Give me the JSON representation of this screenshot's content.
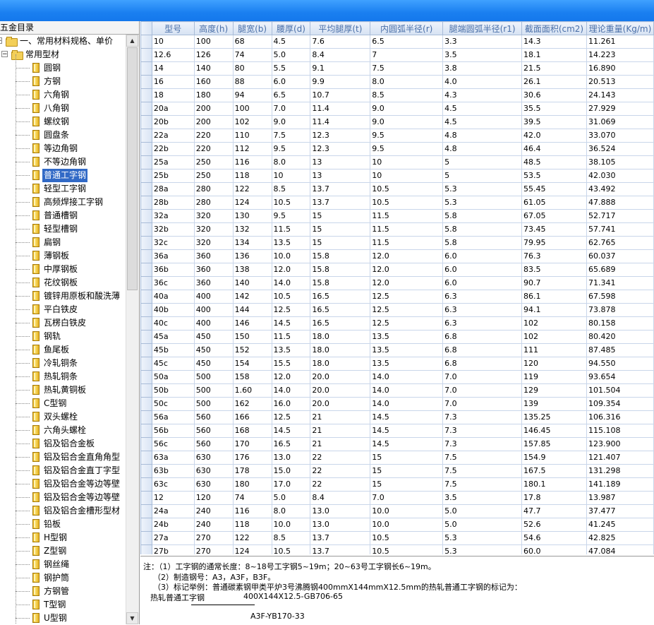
{
  "panel": {
    "title": "五金目录"
  },
  "tree": [
    {
      "label": "一、常用材料规格、单价",
      "level": 0,
      "kind": "folder",
      "expanded": true
    },
    {
      "label": "常用型材",
      "level": 1,
      "kind": "folder",
      "expanded": true
    },
    {
      "label": "圆钢",
      "level": 2,
      "kind": "book"
    },
    {
      "label": "方钢",
      "level": 2,
      "kind": "book"
    },
    {
      "label": "六角钢",
      "level": 2,
      "kind": "book"
    },
    {
      "label": "八角钢",
      "level": 2,
      "kind": "book"
    },
    {
      "label": "螺纹钢",
      "level": 2,
      "kind": "book"
    },
    {
      "label": "圆盘条",
      "level": 2,
      "kind": "book"
    },
    {
      "label": "等边角钢",
      "level": 2,
      "kind": "book"
    },
    {
      "label": "不等边角钢",
      "level": 2,
      "kind": "book"
    },
    {
      "label": "普通工字钢",
      "level": 2,
      "kind": "book",
      "selected": true
    },
    {
      "label": "轻型工字钢",
      "level": 2,
      "kind": "book"
    },
    {
      "label": "高频焊接工字钢",
      "level": 2,
      "kind": "book"
    },
    {
      "label": "普通槽钢",
      "level": 2,
      "kind": "book"
    },
    {
      "label": "轻型槽钢",
      "level": 2,
      "kind": "book"
    },
    {
      "label": "扁钢",
      "level": 2,
      "kind": "book"
    },
    {
      "label": "薄钢板",
      "level": 2,
      "kind": "book"
    },
    {
      "label": "中厚钢板",
      "level": 2,
      "kind": "book"
    },
    {
      "label": "花纹钢板",
      "level": 2,
      "kind": "book"
    },
    {
      "label": "镀锌用原板和酸洗薄",
      "level": 2,
      "kind": "book"
    },
    {
      "label": "平白铁皮",
      "level": 2,
      "kind": "book"
    },
    {
      "label": "瓦楞白铁皮",
      "level": 2,
      "kind": "book"
    },
    {
      "label": "钢轨",
      "level": 2,
      "kind": "book"
    },
    {
      "label": "鱼尾板",
      "level": 2,
      "kind": "book"
    },
    {
      "label": "冷轧铜条",
      "level": 2,
      "kind": "book"
    },
    {
      "label": "热轧铜条",
      "level": 2,
      "kind": "book"
    },
    {
      "label": "热轧黄铜板",
      "level": 2,
      "kind": "book"
    },
    {
      "label": "C型钢",
      "level": 2,
      "kind": "book"
    },
    {
      "label": "双头螺栓",
      "level": 2,
      "kind": "book"
    },
    {
      "label": "六角头螺栓",
      "level": 2,
      "kind": "book"
    },
    {
      "label": "铝及铝合金板",
      "level": 2,
      "kind": "book"
    },
    {
      "label": "铝及铝合金直角角型",
      "level": 2,
      "kind": "book"
    },
    {
      "label": "铝及铝合金直丁字型",
      "level": 2,
      "kind": "book"
    },
    {
      "label": "铝及铝合金等边等壁",
      "level": 2,
      "kind": "book"
    },
    {
      "label": "铝及铝合金等边等壁",
      "level": 2,
      "kind": "book"
    },
    {
      "label": "铝及铝合金槽形型材",
      "level": 2,
      "kind": "book"
    },
    {
      "label": "铅板",
      "level": 2,
      "kind": "book"
    },
    {
      "label": "H型钢",
      "level": 2,
      "kind": "book"
    },
    {
      "label": "Z型钢",
      "level": 2,
      "kind": "book"
    },
    {
      "label": "钢丝绳",
      "level": 2,
      "kind": "book"
    },
    {
      "label": "钢护筒",
      "level": 2,
      "kind": "book"
    },
    {
      "label": "方钢管",
      "level": 2,
      "kind": "book"
    },
    {
      "label": "T型钢",
      "level": 2,
      "kind": "book"
    },
    {
      "label": "U型钢",
      "level": 2,
      "kind": "book"
    }
  ],
  "grid": {
    "columns": [
      "型号",
      "高度(h)",
      "腿宽(b)",
      "腰厚(d)",
      "平均腿厚(t)",
      "内圆弧半径(r)",
      "腿端圆弧半径(r1)",
      "截面面积(cm2)",
      "理论重量(Kg/m)"
    ],
    "rows": [
      [
        "10",
        "100",
        "68",
        "4.5",
        "7.6",
        "6.5",
        "3.3",
        "14.3",
        "11.261"
      ],
      [
        "12.6",
        "126",
        "74",
        "5.0",
        "8.4",
        "7",
        "3.5",
        "18.1",
        "14.223"
      ],
      [
        "14",
        "140",
        "80",
        "5.5",
        "9.1",
        "7.5",
        "3.8",
        "21.5",
        "16.890"
      ],
      [
        "16",
        "160",
        "88",
        "6.0",
        "9.9",
        "8.0",
        "4.0",
        "26.1",
        "20.513"
      ],
      [
        "18",
        "180",
        "94",
        "6.5",
        "10.7",
        "8.5",
        "4.3",
        "30.6",
        "24.143"
      ],
      [
        "20a",
        "200",
        "100",
        "7.0",
        "11.4",
        "9.0",
        "4.5",
        "35.5",
        "27.929"
      ],
      [
        "20b",
        "200",
        "102",
        "9.0",
        "11.4",
        "9.0",
        "4.5",
        "39.5",
        "31.069"
      ],
      [
        "22a",
        "220",
        "110",
        "7.5",
        "12.3",
        "9.5",
        "4.8",
        "42.0",
        "33.070"
      ],
      [
        "22b",
        "220",
        "112",
        "9.5",
        "12.3",
        "9.5",
        "4.8",
        "46.4",
        "36.524"
      ],
      [
        "25a",
        "250",
        "116",
        "8.0",
        "13",
        "10",
        "5",
        "48.5",
        "38.105"
      ],
      [
        "25b",
        "250",
        "118",
        "10",
        "13",
        "10",
        "5",
        "53.5",
        "42.030"
      ],
      [
        "28a",
        "280",
        "122",
        "8.5",
        "13.7",
        "10.5",
        "5.3",
        "55.45",
        "43.492"
      ],
      [
        "28b",
        "280",
        "124",
        "10.5",
        "13.7",
        "10.5",
        "5.3",
        "61.05",
        "47.888"
      ],
      [
        "32a",
        "320",
        "130",
        "9.5",
        "15",
        "11.5",
        "5.8",
        "67.05",
        "52.717"
      ],
      [
        "32b",
        "320",
        "132",
        "11.5",
        "15",
        "11.5",
        "5.8",
        "73.45",
        "57.741"
      ],
      [
        "32c",
        "320",
        "134",
        "13.5",
        "15",
        "11.5",
        "5.8",
        "79.95",
        "62.765"
      ],
      [
        "36a",
        "360",
        "136",
        "10.0",
        "15.8",
        "12.0",
        "6.0",
        "76.3",
        "60.037"
      ],
      [
        "36b",
        "360",
        "138",
        "12.0",
        "15.8",
        "12.0",
        "6.0",
        "83.5",
        "65.689"
      ],
      [
        "36c",
        "360",
        "140",
        "14.0",
        "15.8",
        "12.0",
        "6.0",
        "90.7",
        "71.341"
      ],
      [
        "40a",
        "400",
        "142",
        "10.5",
        "16.5",
        "12.5",
        "6.3",
        "86.1",
        "67.598"
      ],
      [
        "40b",
        "400",
        "144",
        "12.5",
        "16.5",
        "12.5",
        "6.3",
        "94.1",
        "73.878"
      ],
      [
        "40c",
        "400",
        "146",
        "14.5",
        "16.5",
        "12.5",
        "6.3",
        "102",
        "80.158"
      ],
      [
        "45a",
        "450",
        "150",
        "11.5",
        "18.0",
        "13.5",
        "6.8",
        "102",
        "80.420"
      ],
      [
        "45b",
        "450",
        "152",
        "13.5",
        "18.0",
        "13.5",
        "6.8",
        "111",
        "87.485"
      ],
      [
        "45c",
        "450",
        "154",
        "15.5",
        "18.0",
        "13.5",
        "6.8",
        "120",
        "94.550"
      ],
      [
        "50a",
        "500",
        "158",
        "12.0",
        "20.0",
        "14.0",
        "7.0",
        "119",
        "93.654"
      ],
      [
        "50b",
        "500",
        "1.60",
        "14.0",
        "20.0",
        "14.0",
        "7.0",
        "129",
        "101.504"
      ],
      [
        "50c",
        "500",
        "162",
        "16.0",
        "20.0",
        "14.0",
        "7.0",
        "139",
        "109.354"
      ],
      [
        "56a",
        "560",
        "166",
        "12.5",
        "21",
        "14.5",
        "7.3",
        "135.25",
        "106.316"
      ],
      [
        "56b",
        "560",
        "168",
        "14.5",
        "21",
        "14.5",
        "7.3",
        "146.45",
        "115.108"
      ],
      [
        "56c",
        "560",
        "170",
        "16.5",
        "21",
        "14.5",
        "7.3",
        "157.85",
        "123.900"
      ],
      [
        "63a",
        "630",
        "176",
        "13.0",
        "22",
        "15",
        "7.5",
        "154.9",
        "121.407"
      ],
      [
        "63b",
        "630",
        "178",
        "15.0",
        "22",
        "15",
        "7.5",
        "167.5",
        "131.298"
      ],
      [
        "63c",
        "630",
        "180",
        "17.0",
        "22",
        "15",
        "7.5",
        "180.1",
        "141.189"
      ],
      [
        "12",
        "120",
        "74",
        "5.0",
        "8.4",
        "7.0",
        "3.5",
        "17.8",
        "13.987"
      ],
      [
        "24a",
        "240",
        "116",
        "8.0",
        "13.0",
        "10.0",
        "5.0",
        "47.7",
        "37.477"
      ],
      [
        "24b",
        "240",
        "118",
        "10.0",
        "13.0",
        "10.0",
        "5.0",
        "52.6",
        "41.245"
      ],
      [
        "27a",
        "270",
        "122",
        "8.5",
        "13.7",
        "10.5",
        "5.3",
        "54.6",
        "42.825"
      ],
      [
        "27b",
        "270",
        "124",
        "10.5",
        "13.7",
        "10.5",
        "5.3",
        "60.0",
        "47.084"
      ]
    ]
  },
  "notes": {
    "line1": "注：（1）工字钢的通常长度：8~18号工字钢5~19m；20~63号工字钢长6~19m。",
    "line2": "（2）制造钢号：A3，A3F，B3F。",
    "line3": "（3）标记举例：普通碳素钢甲类平炉3号沸腾钢400mmX144mmX12.5mm的热轧普通工字钢的标记为：",
    "mark_left": "热轧普通工字钢",
    "mark_top": "400X144X12.5-GB706-65",
    "mark_bottom": "A3F-YB170-33"
  }
}
